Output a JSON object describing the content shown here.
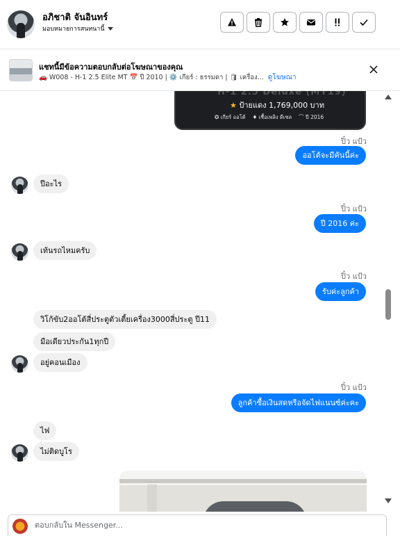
{
  "header": {
    "contact_name": "อภิชาติ จันอินทร์",
    "assign_label": "มอบหมายการสนทนานี้",
    "actions": [
      {
        "name": "report-spam-button",
        "icon": "warning-icon"
      },
      {
        "name": "delete-button",
        "icon": "trash-icon"
      },
      {
        "name": "star-button",
        "icon": "star-icon"
      },
      {
        "name": "mark-unread-button",
        "icon": "envelope-icon"
      },
      {
        "name": "follow-up-button",
        "icon": "exclamation-icon"
      },
      {
        "name": "mark-done-button",
        "icon": "check-icon"
      }
    ]
  },
  "ad_bar": {
    "title": "แชทนี้มีข้อความตอบกลับต่อโฆษณาของคุณ",
    "details": "🚗 W008 - H-1 2.5 Elite MT 📅 ปี 2010 | ⚙️ เกียร์ : ธรรมดา | 🛢 เครื่อง...",
    "link_label": "ดูโฆษณา"
  },
  "car_card": {
    "partial_title": "H-1 2.5 Deluxe (MY19)",
    "price": "ป้ายแดง 1,769,000 บาท",
    "spec_gear": "✪ เกียร์ ออโต้",
    "spec_fuel": "♦ เชื้อเพลิง ดีเซล",
    "spec_year": "⌒ ปี 2016"
  },
  "messages": [
    {
      "sender": "ปิ๋ว แป้ว",
      "text": "ออโต้จะมีคันนี้ค่ะ"
    },
    {
      "text": "ปีอะไร"
    },
    {
      "sender": "ปิ๋ว แป้ว",
      "text": "ปี 2016 ค่ะ"
    },
    {
      "text": "เท้นรถไหมครับ"
    },
    {
      "sender": "ปิ๋ว แป้ว",
      "text": "รับค่ะลูกค้า"
    },
    {
      "text": "วิโก้ขับ2ออโต้สี่ประตูตัวเตี้ยเครื่อง3000สี่ประตู ปี11"
    },
    {
      "text": "มือเดียวประกัน1ทุกปี"
    },
    {
      "text": "อยู่คอนเมือง"
    },
    {
      "sender": "ปิ๋ว แป้ว",
      "text": "ลูกค้าซื้อเงินสดหรือจัดไฟแนนซ์ค่ะคะ"
    },
    {
      "text": "ไฟ"
    },
    {
      "text": "ไม่ติดบูโร"
    }
  ],
  "composer": {
    "placeholder": "ตอบกลับใน Messenger..."
  },
  "colors": {
    "outgoing_bubble": "#0a7cff",
    "incoming_bubble": "#f0f0f0",
    "link": "#1877f2"
  }
}
